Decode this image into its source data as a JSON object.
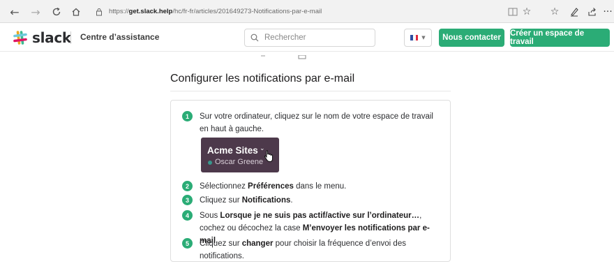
{
  "browser": {
    "url_prefix": "https://",
    "url_domain": "get.slack.help",
    "url_path": "/hc/fr-fr/articles/201649273-Notifications-par-e-mail"
  },
  "header": {
    "logo_text": "slack",
    "help_center": "Centre d’assistance",
    "search_placeholder": "Rechercher",
    "contact_button": "Nous contacter",
    "create_button": "Créer un espace de travail",
    "accent_color": "#2bac76"
  },
  "article": {
    "title": "Configurer les notifications par e-mail",
    "workspace_card": {
      "name": "Acme Sites",
      "user": "Oscar Greene",
      "bg_color": "#4d394b"
    },
    "steps": [
      {
        "num": "1",
        "parts": [
          {
            "t": "Sur votre ordinateur, cliquez sur le nom de votre espace de travail en haut à gauche."
          }
        ]
      },
      {
        "num": "2",
        "parts": [
          {
            "t": "Sélectionnez "
          },
          {
            "t": "Préférences",
            "b": true
          },
          {
            "t": " dans le menu."
          }
        ]
      },
      {
        "num": "3",
        "parts": [
          {
            "t": "Cliquez sur "
          },
          {
            "t": "Notifications",
            "b": true
          },
          {
            "t": "."
          }
        ]
      },
      {
        "num": "4",
        "parts": [
          {
            "t": "Sous "
          },
          {
            "t": "Lorsque je ne suis pas actif/active sur l’ordinateur…",
            "b": true
          },
          {
            "t": ", cochez ou décochez la case "
          },
          {
            "t": "M’envoyer les notifications par e-mail",
            "b": true
          },
          {
            "t": "."
          }
        ]
      },
      {
        "num": "5",
        "parts": [
          {
            "t": "Cliquez sur "
          },
          {
            "t": "changer",
            "b": true
          },
          {
            "t": " pour choisir la fréquence d’envoi des notifications."
          }
        ]
      }
    ]
  }
}
